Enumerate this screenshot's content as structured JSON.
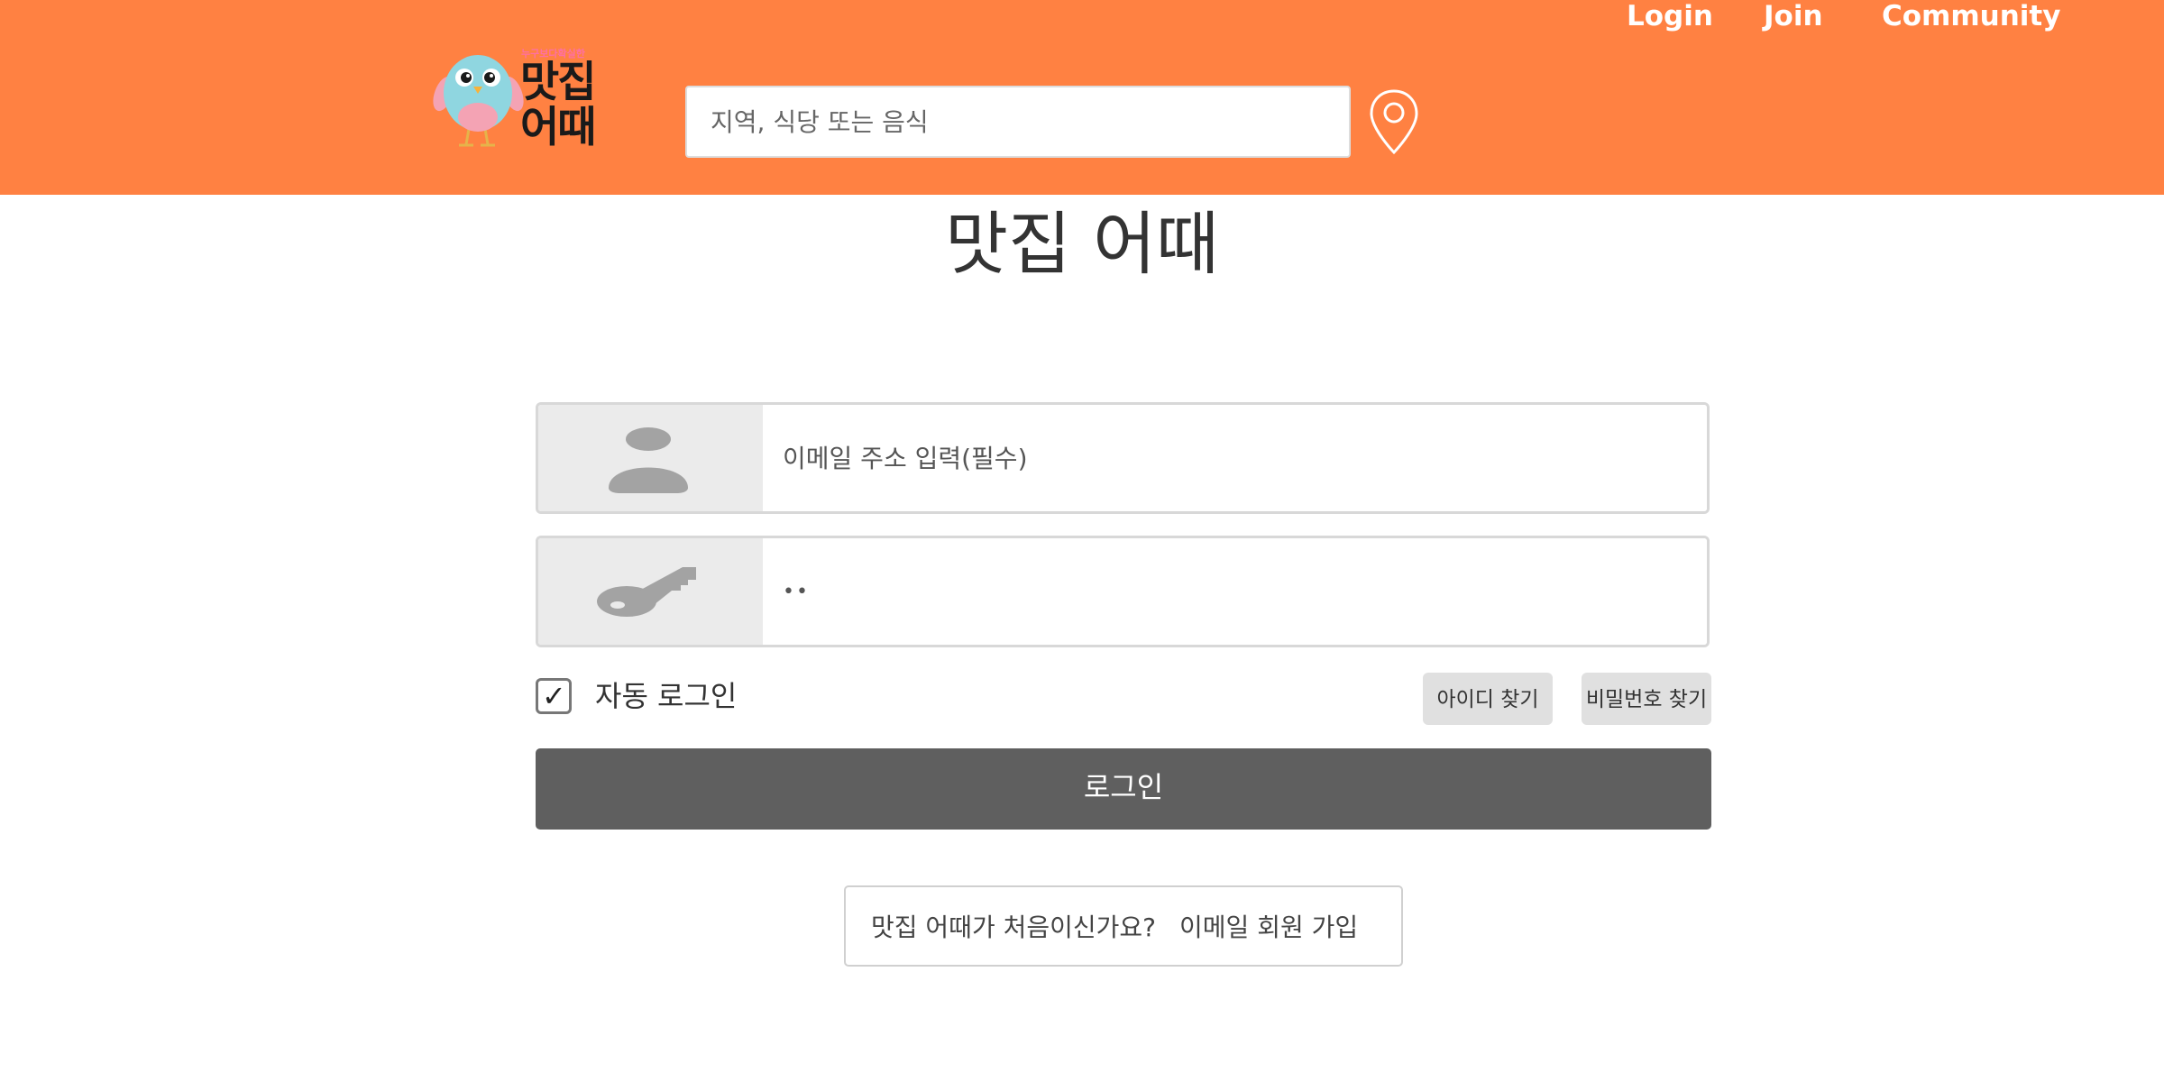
{
  "header": {
    "nav": {
      "login": "Login",
      "join": "Join",
      "community": "Community"
    },
    "logo": {
      "tagline": "누구보다확실한",
      "line1": "맛집",
      "line2": "어때"
    },
    "search": {
      "placeholder": "지역, 식당 또는 음식"
    },
    "location_icon": "map-pin-icon"
  },
  "main": {
    "title": "맛집 어때",
    "email": {
      "placeholder": "이메일 주소 입력(필수)",
      "icon": "user-icon"
    },
    "password": {
      "value": "••",
      "icon": "key-icon"
    },
    "auto_login": {
      "checked": true,
      "label": "자동 로그인",
      "check_mark": "✓"
    },
    "find_id_label": "아이디 찾기",
    "find_pw_label": "비밀번호 찾기",
    "login_label": "로그인",
    "signup": {
      "prompt": "맛집 어때가 처음이신가요?",
      "link": "이메일 회원 가입"
    }
  },
  "colors": {
    "header_bg": "#ff8142",
    "login_button": "#5f5f5f",
    "icon_gray": "#a3a3a3"
  }
}
